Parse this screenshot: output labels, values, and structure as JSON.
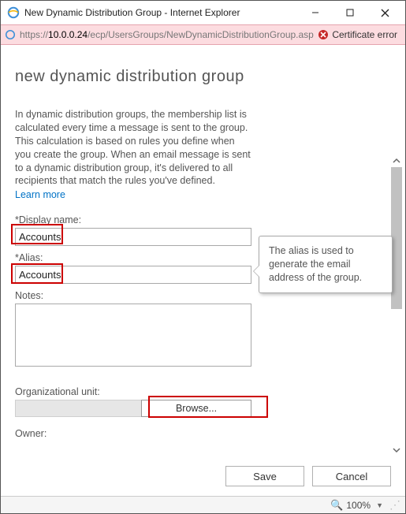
{
  "window": {
    "title": "New Dynamic Distribution Group - Internet Explorer"
  },
  "urlbar": {
    "protocol": "https://",
    "host": "10.0.0.24",
    "path": "/ecp/UsersGroups/NewDynamicDistributionGroup.asp",
    "cert_error": "Certificate error"
  },
  "page": {
    "title": "new dynamic distribution group",
    "description": "In dynamic distribution groups, the membership list is calculated every time a message is sent to the group. This calculation is based on rules you define when you create the group. When an email message is sent to a dynamic distribution group, it's delivered to all recipients that match the rules you've defined.",
    "learn_more": "Learn more"
  },
  "fields": {
    "display_name": {
      "label": "*Display name:",
      "value": "Accounts"
    },
    "alias": {
      "label": "*Alias:",
      "value": "Accounts"
    },
    "notes": {
      "label": "Notes:",
      "value": ""
    },
    "org_unit": {
      "label": "Organizational unit:",
      "value": "",
      "browse": "Browse..."
    },
    "owner": {
      "label": "Owner:"
    }
  },
  "tooltip": {
    "alias": "The alias is used to generate the email address of the group."
  },
  "buttons": {
    "save": "Save",
    "cancel": "Cancel"
  },
  "status": {
    "zoom": "100%"
  }
}
